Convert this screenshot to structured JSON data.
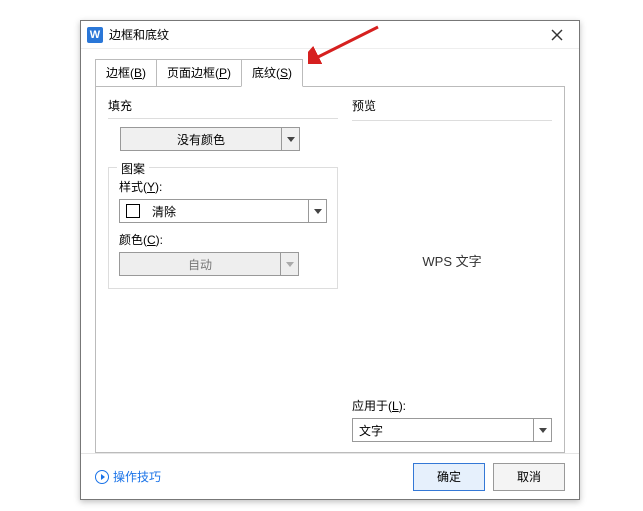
{
  "window": {
    "app_icon_letter": "W",
    "title": "边框和底纹"
  },
  "tabs": {
    "items": [
      {
        "prefix": "边框(",
        "key": "B",
        "suffix": ")"
      },
      {
        "prefix": "页面边框(",
        "key": "P",
        "suffix": ")"
      },
      {
        "prefix": "底纹(",
        "key": "S",
        "suffix": ")"
      }
    ],
    "active_index": 2
  },
  "fill": {
    "label": "填充",
    "value": "没有颜色"
  },
  "pattern": {
    "group_label": "图案",
    "style_label_prefix": "样式(",
    "style_key": "Y",
    "style_label_suffix": "):",
    "style_value": "清除",
    "color_label_prefix": "颜色(",
    "color_key": "C",
    "color_label_suffix": "):",
    "color_value": "自动"
  },
  "preview": {
    "label": "预览",
    "text": "WPS 文字",
    "apply_label_prefix": "应用于(",
    "apply_key": "L",
    "apply_label_suffix": "):",
    "apply_value": "文字"
  },
  "footer": {
    "tips_label": "操作技巧",
    "ok": "确定",
    "cancel": "取消"
  }
}
